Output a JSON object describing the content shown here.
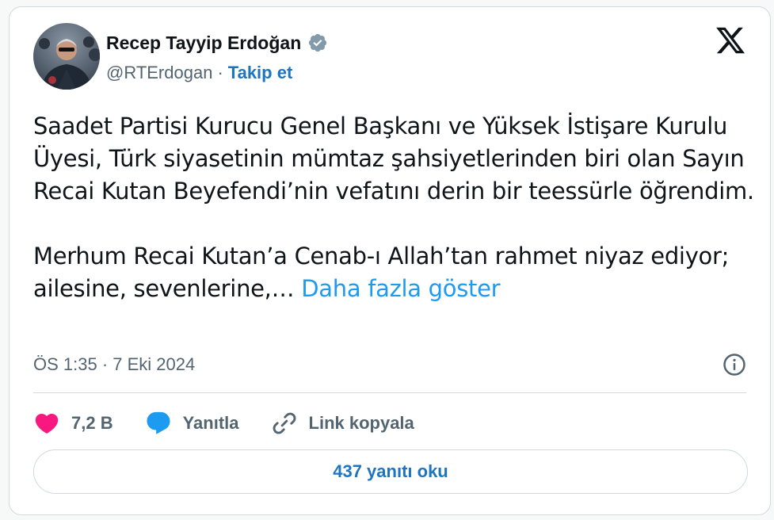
{
  "author": {
    "name": "Recep Tayyip Erdoğan",
    "handle": "@RTErdogan",
    "separator": "·",
    "follow_label": "Takip et"
  },
  "tweet": {
    "paragraph1": "Saadet Partisi Kurucu Genel Başkanı ve Yüksek İstişare Kurulu Üyesi, Türk siyasetinin mümtaz şahsiyetlerinden biri olan Sayın Recai Kutan Beyefendi’nin vefatını derin bir teessürle öğrendim.",
    "paragraph2": "Merhum Recai Kutan’a Cenab-ı Allah’tan rahmet niyaz ediyor; ailesine, sevenlerine,…",
    "show_more": "Daha fazla göster",
    "timestamp": "ÖS 1:35 · 7 Eki 2024"
  },
  "actions": {
    "like_count": "7,2 B",
    "reply_label": "Yanıtla",
    "copy_link_label": "Link kopyala"
  },
  "replies_button": "437 yanıtı oku",
  "colors": {
    "like": "#f91880",
    "reply": "#1d9bf0",
    "verified": "#829aab",
    "link": "#1d9bf0",
    "follow": "#1d75c0"
  },
  "icons": {
    "verified": "verified-badge-icon",
    "x_logo": "x-logo-icon",
    "info": "info-icon",
    "like": "heart-icon",
    "reply": "speech-bubble-icon",
    "copy_link": "link-icon"
  }
}
